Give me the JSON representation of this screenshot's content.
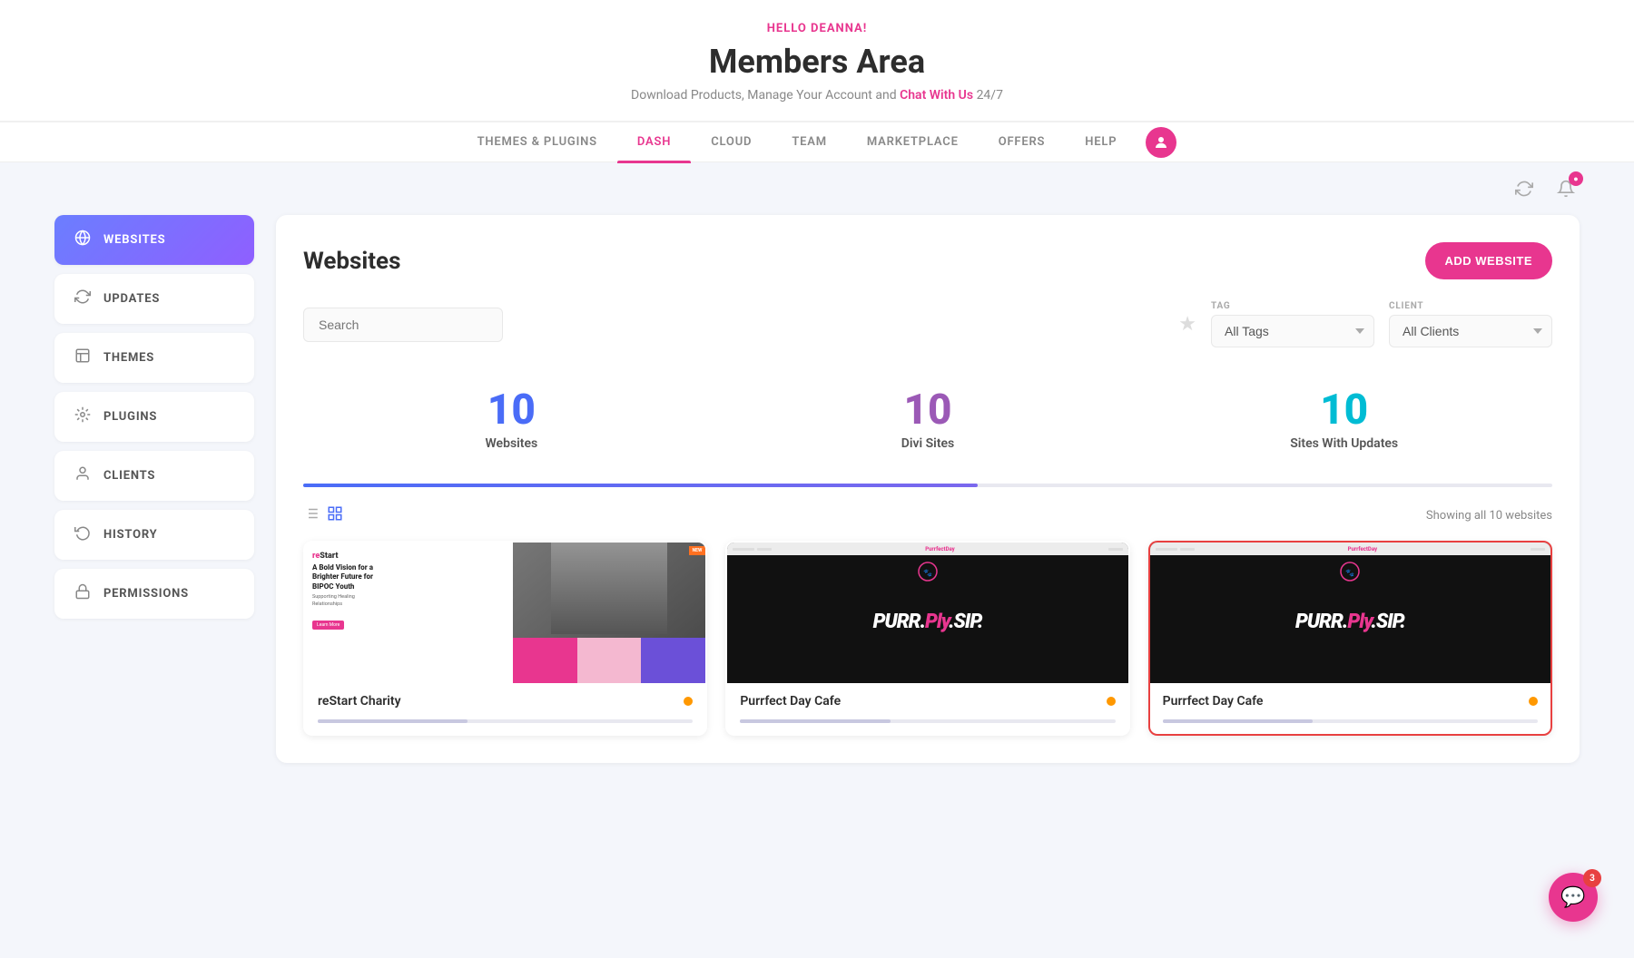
{
  "header": {
    "hello_text": "HELLO DEANNA!",
    "page_title": "Members Area",
    "subtitle_text": "Download Products, Manage Your Account and",
    "chat_link": "Chat With Us",
    "subtitle_suffix": "24/7"
  },
  "nav": {
    "tabs": [
      {
        "id": "themes-plugins",
        "label": "THEMES & PLUGINS",
        "active": false
      },
      {
        "id": "dash",
        "label": "DASH",
        "active": true
      },
      {
        "id": "cloud",
        "label": "CLOUD",
        "active": false
      },
      {
        "id": "team",
        "label": "TEAM",
        "active": false
      },
      {
        "id": "marketplace",
        "label": "MARKETPLACE",
        "active": false
      },
      {
        "id": "offers",
        "label": "OFFERS",
        "active": false
      },
      {
        "id": "help",
        "label": "HELP",
        "active": false
      }
    ]
  },
  "toolbar": {
    "refresh_title": "Refresh",
    "notif_title": "Notifications",
    "notif_count": ""
  },
  "sidebar": {
    "items": [
      {
        "id": "websites",
        "label": "WEBSITES",
        "icon": "🌐",
        "active": true
      },
      {
        "id": "updates",
        "label": "UPDATES",
        "icon": "🔄",
        "active": false
      },
      {
        "id": "themes",
        "label": "THEMES",
        "icon": "🖼",
        "active": false
      },
      {
        "id": "plugins",
        "label": "PLUGINS",
        "icon": "⏱",
        "active": false
      },
      {
        "id": "clients",
        "label": "CLIENTS",
        "icon": "👤",
        "active": false
      },
      {
        "id": "history",
        "label": "HISTORY",
        "icon": "🔄",
        "active": false
      },
      {
        "id": "permissions",
        "label": "PERMISSIONS",
        "icon": "🔑",
        "active": false
      }
    ]
  },
  "content": {
    "title": "Websites",
    "add_button": "ADD WEBSITE",
    "search_placeholder": "Search",
    "tag_label": "TAG",
    "tag_default": "All Tags",
    "client_label": "CLIENT",
    "client_default": "All Clients",
    "stats": [
      {
        "number": "10",
        "label": "Websites",
        "color": "blue"
      },
      {
        "number": "10",
        "label": "Divi Sites",
        "color": "purple"
      },
      {
        "number": "10",
        "label": "Sites With Updates",
        "color": "teal"
      }
    ],
    "showing_text": "Showing all 10 websites",
    "cards": [
      {
        "id": "restart-charity",
        "name": "reStart Charity",
        "type": "restart",
        "highlighted": false
      },
      {
        "id": "purrfect-day-cafe-1",
        "name": "Purrfect Day Cafe",
        "type": "purr",
        "highlighted": false
      },
      {
        "id": "purrfect-day-cafe-2",
        "name": "Purrfect Day Cafe",
        "type": "purr",
        "highlighted": true
      }
    ]
  },
  "chat": {
    "badge": "3"
  }
}
